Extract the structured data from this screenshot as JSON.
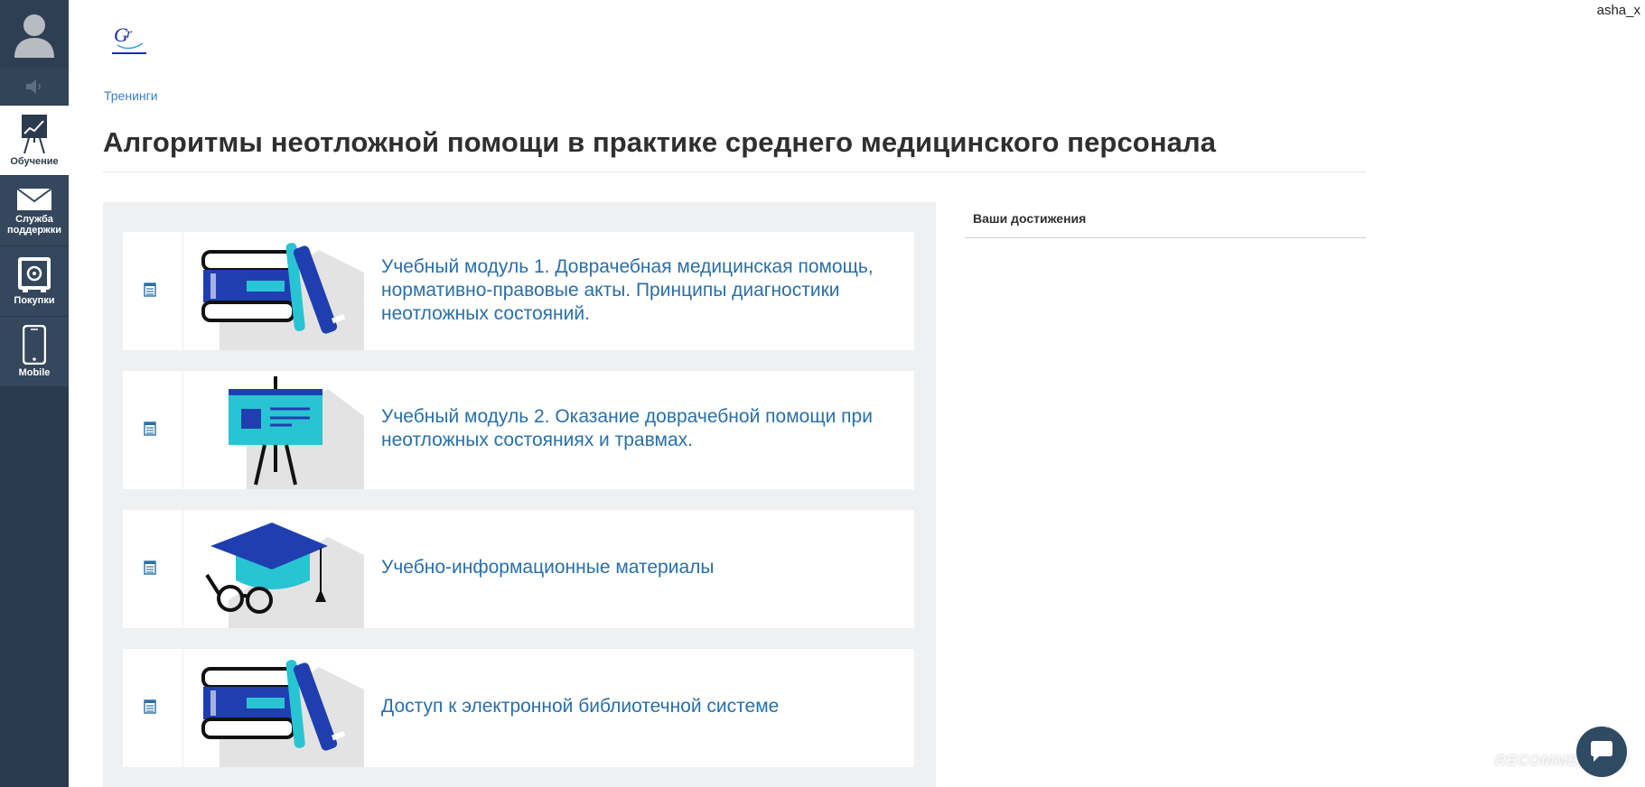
{
  "user": {
    "name": "asha_x"
  },
  "sidebar": {
    "items": [
      {
        "label": "Обучение",
        "icon": "chart-easel-icon"
      },
      {
        "label": "Служба\nподдержки",
        "icon": "envelope-icon"
      },
      {
        "label": "Покупки",
        "icon": "safe-icon"
      },
      {
        "label": "Mobile",
        "icon": "smartphone-icon"
      }
    ]
  },
  "breadcrumb": "Тренинги",
  "page_title": "Алгоритмы неотложной помощи в практике среднего медицинского персонала",
  "modules": [
    {
      "title": "Учебный модуль 1. Доврачебная медицинская помощь, нормативно-правовые акты. Принципы диагностики неотложных состояний.",
      "illustration": "books-illustration"
    },
    {
      "title": "Учебный модуль 2. Оказание доврачебной помощи при неотложных состояниях и травмах.",
      "illustration": "presentation-board-illustration"
    },
    {
      "title": "Учебно-информационные материалы",
      "illustration": "graduation-cap-illustration"
    },
    {
      "title": "Доступ к электронной библиотечной системе",
      "illustration": "books-illustration"
    }
  ],
  "achievements": {
    "title": "Ваши достижения"
  },
  "watermark": "RECOMMEND.RU",
  "colors": {
    "sidebar": "#2b3a4e",
    "link": "#3a7fc1",
    "module_title": "#2a6fa8",
    "panel_bg": "#eef0f2",
    "illus_blue": "#1f3fb0",
    "illus_teal": "#29c4d3"
  }
}
